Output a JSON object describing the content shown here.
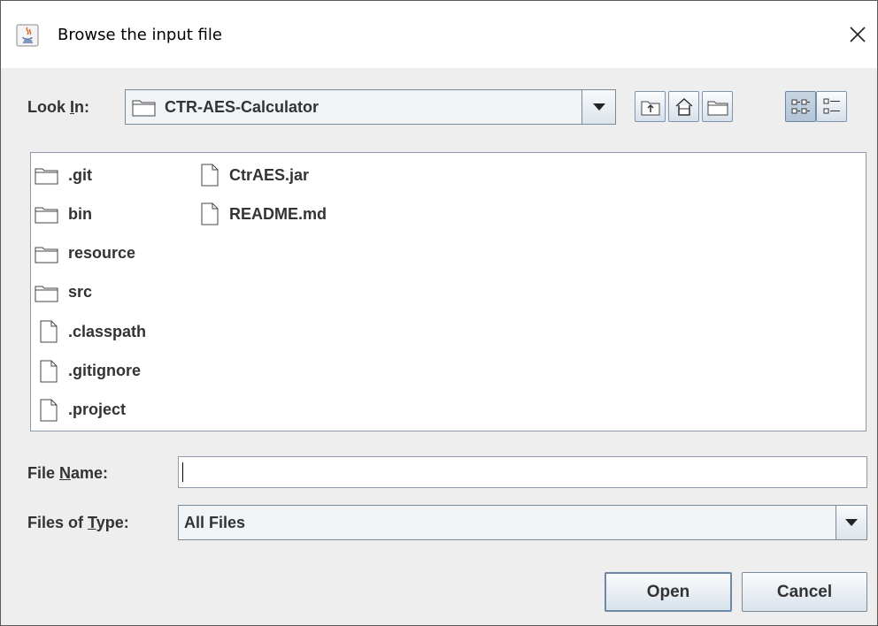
{
  "window": {
    "title": "Browse the input file"
  },
  "look_in": {
    "label_prefix": "Look ",
    "label_mnemonic": "I",
    "label_suffix": "n:",
    "selected": "CTR-AES-Calculator"
  },
  "toolbar": {
    "buttons": [
      "up-one-level",
      "home",
      "new-folder",
      "list-view",
      "details-view"
    ]
  },
  "files": [
    {
      "name": ".git",
      "type": "folder"
    },
    {
      "name": "bin",
      "type": "folder"
    },
    {
      "name": "resource",
      "type": "folder"
    },
    {
      "name": "src",
      "type": "folder"
    },
    {
      "name": ".classpath",
      "type": "file"
    },
    {
      "name": ".gitignore",
      "type": "file"
    },
    {
      "name": ".project",
      "type": "file"
    },
    {
      "name": "CtrAES.jar",
      "type": "file"
    },
    {
      "name": "README.md",
      "type": "file"
    }
  ],
  "file_name": {
    "label_prefix": "File ",
    "label_mnemonic": "N",
    "label_suffix": "ame:",
    "value": ""
  },
  "file_type": {
    "label_prefix": "Files of ",
    "label_mnemonic": "T",
    "label_suffix": "ype:",
    "selected": "All Files"
  },
  "buttons": {
    "open": "Open",
    "cancel": "Cancel"
  },
  "colors": {
    "dialog_bg": "#eeeeee",
    "button_top": "#fbfcfd",
    "button_bottom": "#d9e2ea",
    "border": "#7a8a99"
  }
}
